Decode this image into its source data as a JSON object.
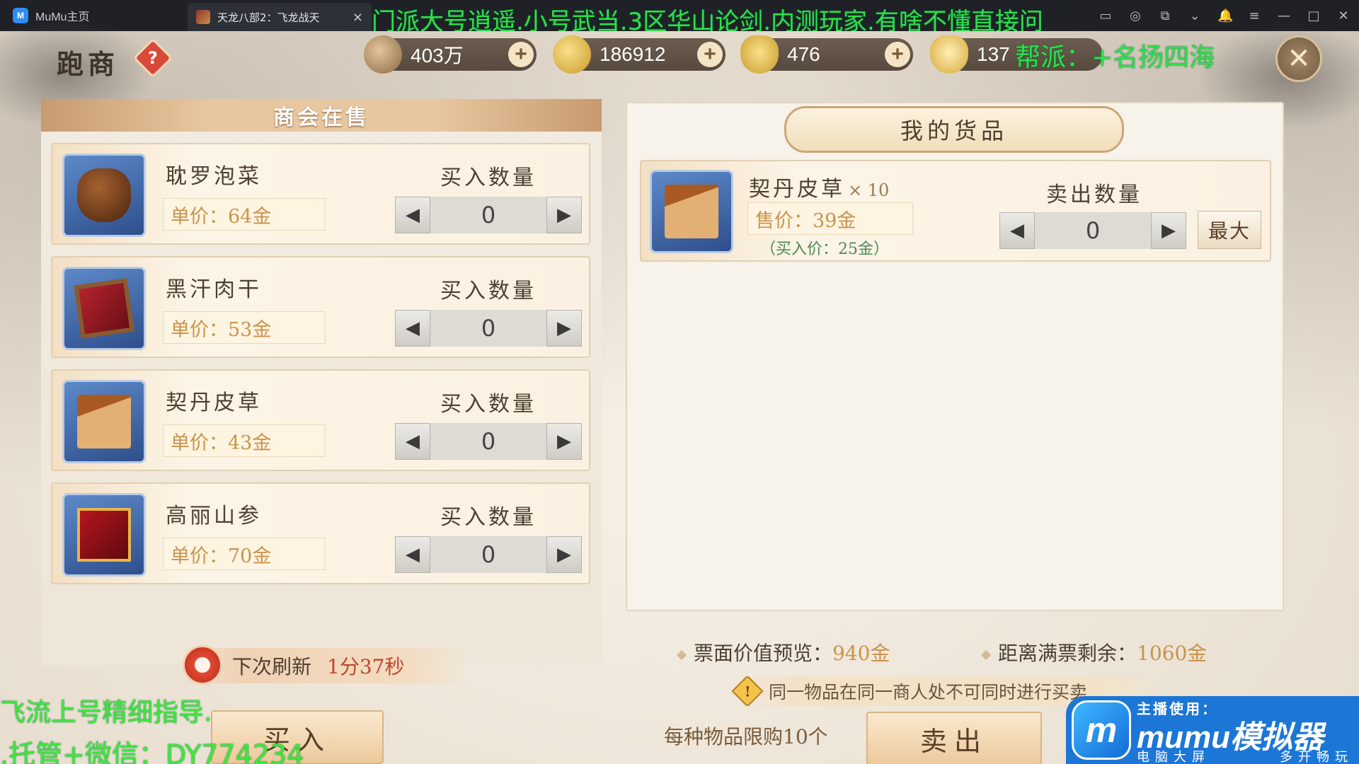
{
  "titlebar": {
    "home_label": "MuMu主页",
    "logo_text": "M",
    "tab_title": "天龙八部2：飞龙战天",
    "tab_close": "×",
    "banner": "门派大号逍遥.小号武当.3区华山论剑.内测玩家.有啥不懂直接问",
    "controls": [
      "▭",
      "◎",
      "⧉",
      "⌄",
      "🔔",
      "≡",
      "—",
      "□",
      "✕"
    ]
  },
  "header": {
    "title": "跑商",
    "help": "?",
    "close": "✕"
  },
  "currency": [
    {
      "value": "403万",
      "icon": "copper-coin-icon"
    },
    {
      "value": "186912",
      "icon": "gold-coin-icon"
    },
    {
      "value": "476",
      "icon": "gold-ingot-icon"
    },
    {
      "value": "137",
      "icon": "ingot-icon"
    }
  ],
  "guild_overlay": "帮派：+名扬四海",
  "shop": {
    "title": "商会在售",
    "qty_label": "买入数量",
    "items": [
      {
        "name": "耽罗泡菜",
        "price": "单价：64金",
        "qty": "0",
        "icon": "kimchi-jar-icon"
      },
      {
        "name": "黑汗肉干",
        "price": "单价：53金",
        "qty": "0",
        "icon": "dried-meat-icon"
      },
      {
        "name": "契丹皮草",
        "price": "单价：43金",
        "qty": "0",
        "icon": "fur-chest-icon"
      },
      {
        "name": "高丽山参",
        "price": "单价：70金",
        "qty": "0",
        "icon": "ginseng-box-icon"
      }
    ],
    "refresh_label": "下次刷新",
    "refresh_time": "1分37秒",
    "buy_label": "买入"
  },
  "goods": {
    "title": "我的货品",
    "item": {
      "name": "契丹皮草",
      "count": "× 10",
      "sell_price": "售价：39金",
      "buy_price": "（买入价：25金）",
      "qty_label": "卖出数量",
      "qty": "0",
      "max_label": "最大"
    },
    "ticket_label": "票面价值预览：",
    "ticket_value": "940金",
    "remain_label": "距离满票剩余：",
    "remain_value": "1060金",
    "notice": "同一物品在同一商人处不可同时进行买卖",
    "limit": "每种物品限购10个",
    "sell_label": "卖出"
  },
  "promo": {
    "line1": "飞流上号精细指导.",
    "line2": ".托管+微信：DY774234"
  },
  "mumu": {
    "logo": "m",
    "top": "主播使用：",
    "name": "mumu模拟器",
    "sub1": "电脑大屏",
    "sub2": "多开畅玩"
  },
  "colors": {
    "overlay_green": "#2fe04a",
    "price_gold": "#c9934a",
    "timer_red": "#c0472c",
    "mumu_blue": "#1c76d6"
  }
}
